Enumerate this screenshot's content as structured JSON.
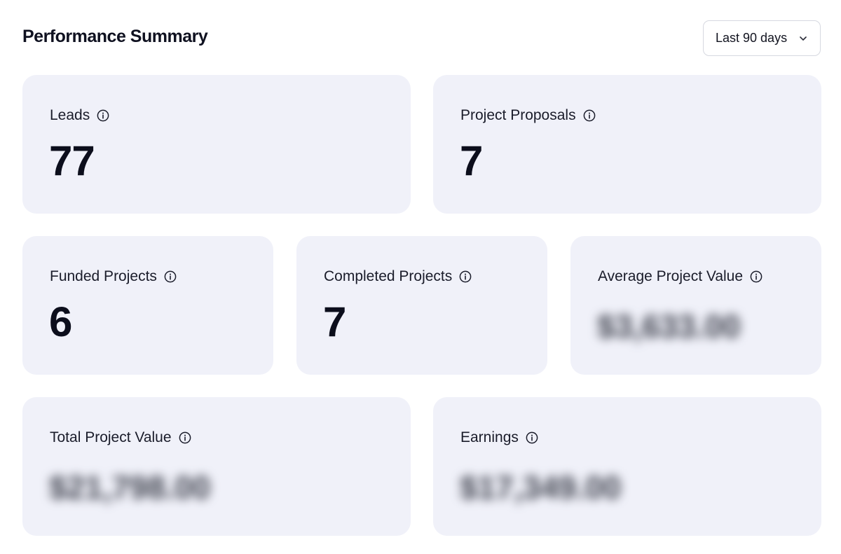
{
  "header": {
    "title": "Performance Summary",
    "range_select": {
      "value": "Last 90 days",
      "icon": "chevron-down-icon"
    }
  },
  "cards": {
    "leads": {
      "label": "Leads",
      "value": "77",
      "icon": "info-icon"
    },
    "project_proposals": {
      "label": "Project Proposals",
      "value": "7",
      "icon": "info-icon"
    },
    "funded_projects": {
      "label": "Funded Projects",
      "value": "6",
      "icon": "info-icon"
    },
    "completed_projects": {
      "label": "Completed Projects",
      "value": "7",
      "icon": "info-icon"
    },
    "average_project_value": {
      "label": "Average Project Value",
      "value": "$3,633.00",
      "icon": "info-icon"
    },
    "total_project_value": {
      "label": "Total Project Value",
      "value": "$21,798.00",
      "icon": "info-icon"
    },
    "earnings": {
      "label": "Earnings",
      "value": "$17,349.00",
      "icon": "info-icon"
    }
  },
  "colors": {
    "card_background": "#f0f1f9",
    "text_primary": "#0f1120",
    "border": "#d6d8e0"
  }
}
